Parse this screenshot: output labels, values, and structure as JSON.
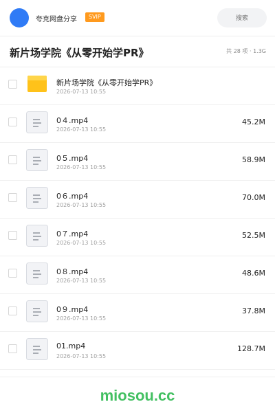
{
  "topbar": {
    "user_name": "夸克网盘分享",
    "badge": "SVIP",
    "search_placeholder": "搜索"
  },
  "header": {
    "title": "新片场学院《从零开始学PR》",
    "summary": "共 28 项 · 1.3G"
  },
  "files": [
    {
      "name": "新片场学院《从零开始学PR》",
      "date": "2026-07-13 10:55",
      "size": "",
      "type": "folder"
    },
    {
      "name": "0４.mp4",
      "date": "2026-07-13 10:55",
      "size": "45.2M",
      "type": "file"
    },
    {
      "name": "0５.mp4",
      "date": "2026-07-13 10:55",
      "size": "58.9M",
      "type": "file"
    },
    {
      "name": "0６.mp4",
      "date": "2026-07-13 10:55",
      "size": "70.0M",
      "type": "file"
    },
    {
      "name": "0７.mp4",
      "date": "2026-07-13 10:55",
      "size": "52.5M",
      "type": "file"
    },
    {
      "name": "0８.mp4",
      "date": "2026-07-13 10:55",
      "size": "48.6M",
      "type": "file"
    },
    {
      "name": "0９.mp4",
      "date": "2026-07-13 10:55",
      "size": "37.8M",
      "type": "file"
    },
    {
      "name": "01.mp4",
      "date": "2026-07-13 10:55",
      "size": "128.7M",
      "type": "file"
    }
  ],
  "footer": {
    "watermark": "miosou.cc"
  },
  "colors": {
    "accent": "#2f7bf6",
    "badge": "#ff9a1e",
    "folder": "#ffc21a",
    "watermark": "#43c062"
  },
  "icons": {
    "folder": "folder-icon",
    "file": "document-icon"
  }
}
